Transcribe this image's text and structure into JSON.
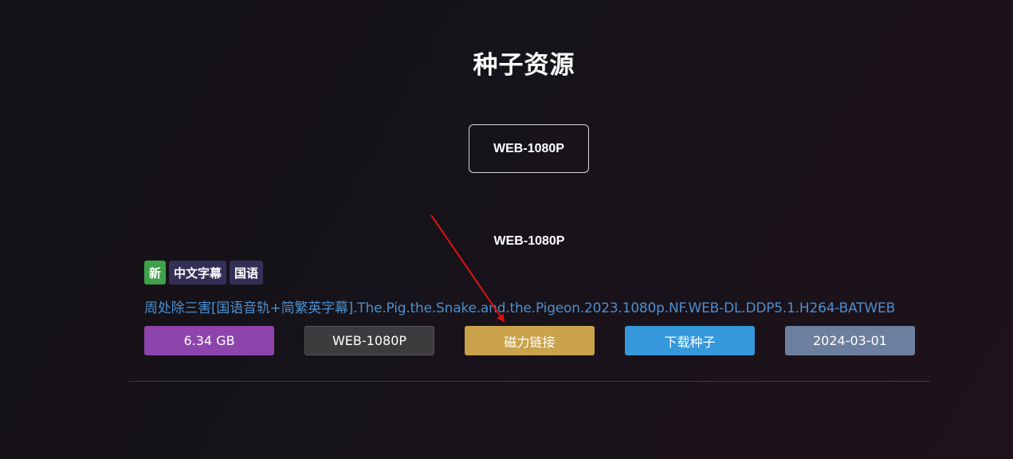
{
  "page": {
    "title": "种子资源"
  },
  "filter": {
    "active_tab": "WEB-1080P"
  },
  "section": {
    "heading": "WEB-1080P",
    "tags": [
      "新",
      "中文字幕",
      "国语"
    ],
    "resource_title": "周处除三害[国语音轨+简繁英字幕].The.Pig.the.Snake.and.the.Pigeon.2023.1080p.NF.WEB-DL.DDP5.1.H264-BATWEB",
    "buttons": {
      "size": "6.34 GB",
      "quality": "WEB-1080P",
      "magnet": "磁力链接",
      "torrent": "下载种子",
      "date": "2024-03-01"
    }
  },
  "colors": {
    "tag_new": "#3fa14b",
    "tag_dark": "#332f57",
    "link": "#4a8fd0",
    "size_button": "#8e44ad",
    "quality_button": "#3c3c3f",
    "magnet_button": "#c9a24a",
    "torrent_button": "#3498db",
    "date_button": "#6d7f9e",
    "annotation_arrow": "#e01010"
  }
}
